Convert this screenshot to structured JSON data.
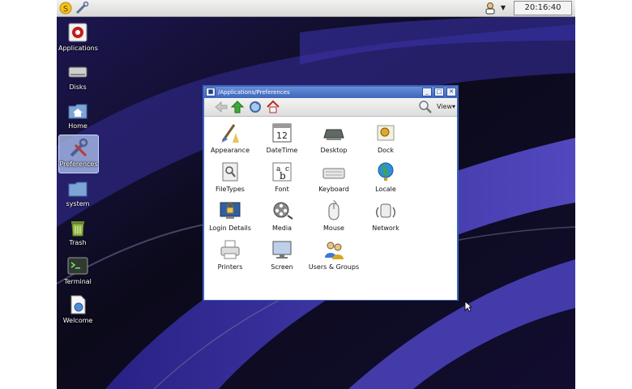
{
  "clock": "20:16:40",
  "desktop_icons": [
    {
      "label": "Applications"
    },
    {
      "label": "Disks"
    },
    {
      "label": "Home"
    },
    {
      "label": "Preferences"
    },
    {
      "label": "system"
    },
    {
      "label": "Trash"
    },
    {
      "label": "Terminal"
    },
    {
      "label": "Welcome"
    }
  ],
  "window": {
    "title": "/Applications/Preferences",
    "view_label": "View",
    "items": [
      {
        "label": "Appearance"
      },
      {
        "label": "DateTime"
      },
      {
        "label": "Desktop"
      },
      {
        "label": "Dock"
      },
      {
        "label": "FileTypes"
      },
      {
        "label": "Font"
      },
      {
        "label": "Keyboard"
      },
      {
        "label": "Locale"
      },
      {
        "label": "Login Details"
      },
      {
        "label": "Media"
      },
      {
        "label": "Mouse"
      },
      {
        "label": "Network"
      },
      {
        "label": "Printers"
      },
      {
        "label": "Screen"
      },
      {
        "label": "Users & Groups"
      }
    ],
    "datetime_icon_text": "12"
  },
  "font_icon_letters": {
    "a": "a",
    "b": "b",
    "c": "c"
  },
  "colors": {
    "accent": "#3a64b9",
    "selection": "#aabeeb",
    "wallpaper_purple": "#2f2a8f"
  }
}
